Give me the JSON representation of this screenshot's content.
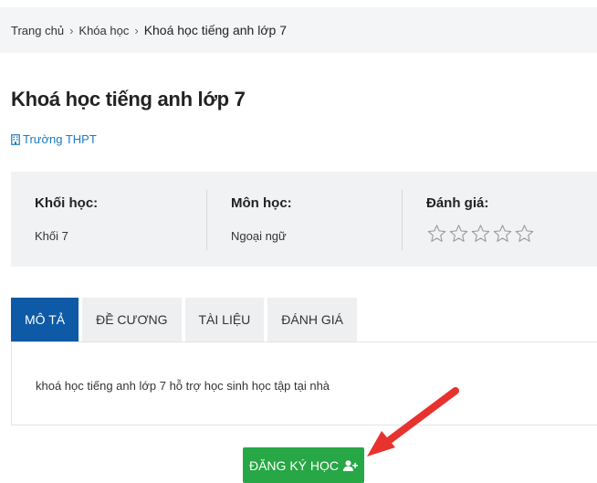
{
  "breadcrumb": {
    "home": "Trang chủ",
    "courses": "Khóa học",
    "current": "Khoá học tiếng anh lớp 7",
    "separator": "›"
  },
  "course": {
    "title": "Khoá học tiếng anh lớp 7",
    "school": "Trường THPT"
  },
  "info": {
    "grade_label": "Khối học:",
    "grade_value": "Khối 7",
    "subject_label": "Môn học:",
    "subject_value": "Ngoại ngữ",
    "rating_label": "Đánh giá:",
    "rating_value": 0,
    "rating_max": 5
  },
  "tabs": [
    {
      "label": "MÔ TẢ",
      "active": true
    },
    {
      "label": "ĐỀ CƯƠNG",
      "active": false
    },
    {
      "label": "TÀI LIỆU",
      "active": false
    },
    {
      "label": "ĐÁNH GIÁ",
      "active": false
    }
  ],
  "description": "khoá học tiếng anh lớp 7 hỗ trợ học sinh học tập tại nhà",
  "enroll_button": "ĐĂNG KÝ HỌC",
  "colors": {
    "primary": "#0e5aa7",
    "link": "#1a7bbf",
    "success": "#27a745",
    "annotation_arrow": "#e8322e"
  },
  "icons": {
    "school": "building-icon",
    "enroll": "user-plus-icon",
    "star": "star-outline-icon"
  }
}
